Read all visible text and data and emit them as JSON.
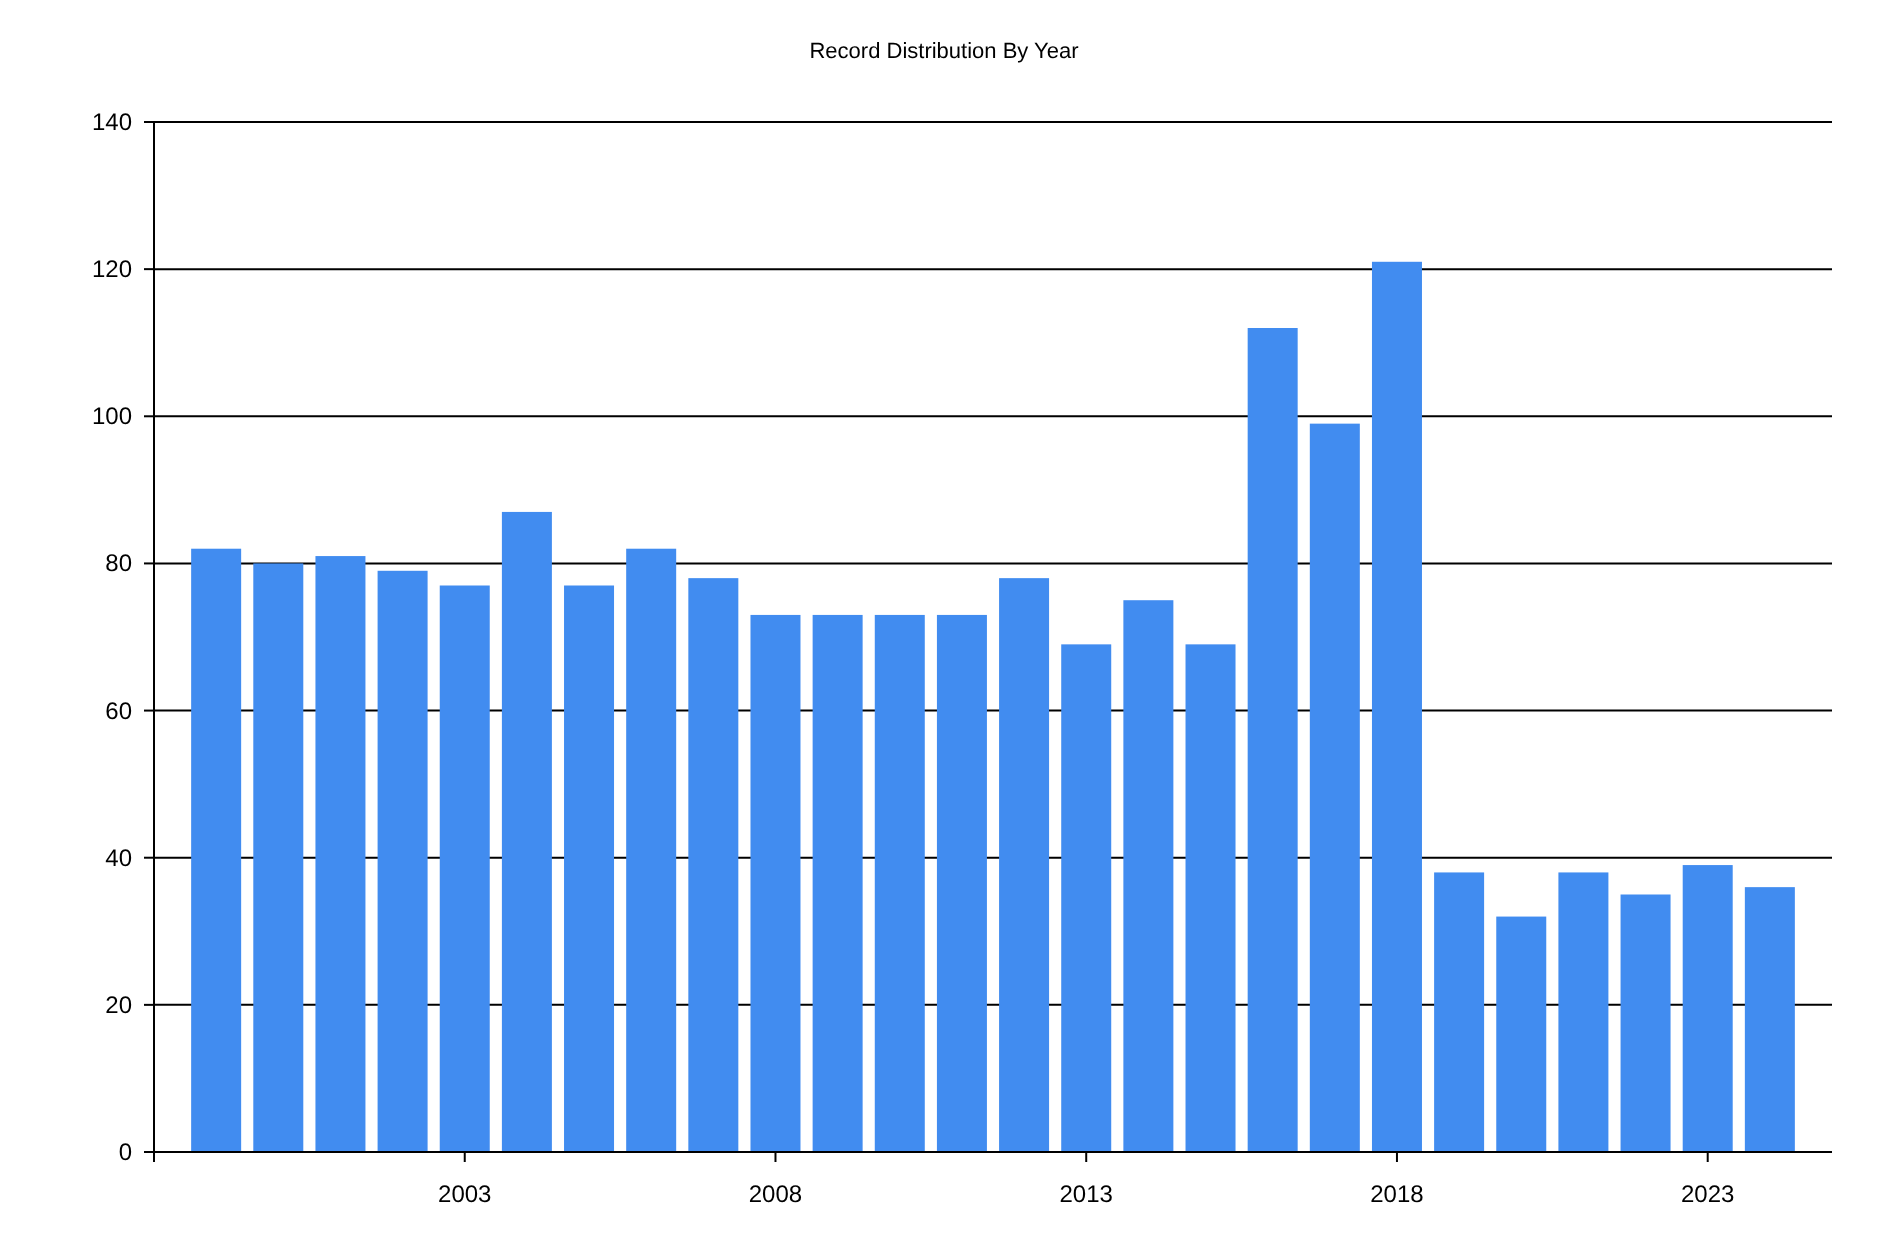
{
  "chart_data": {
    "type": "bar",
    "title": "Record Distribution By Year",
    "x": [
      1999,
      2000,
      2001,
      2002,
      2003,
      2004,
      2005,
      2006,
      2007,
      2008,
      2009,
      2010,
      2011,
      2012,
      2013,
      2014,
      2015,
      2016,
      2017,
      2018,
      2019,
      2020,
      2021,
      2022,
      2023,
      2024
    ],
    "values": [
      82,
      80,
      81,
      79,
      77,
      87,
      77,
      82,
      78,
      73,
      73,
      73,
      73,
      78,
      69,
      75,
      69,
      112,
      99,
      121,
      38,
      32,
      38,
      35,
      39,
      36
    ],
    "xlim": [
      1998,
      2025
    ],
    "ylim": [
      0,
      140
    ],
    "xticks": [
      2003,
      2008,
      2013,
      2018,
      2023
    ],
    "yticks": [
      0,
      20,
      40,
      60,
      80,
      100,
      120,
      140
    ],
    "grid": true
  }
}
